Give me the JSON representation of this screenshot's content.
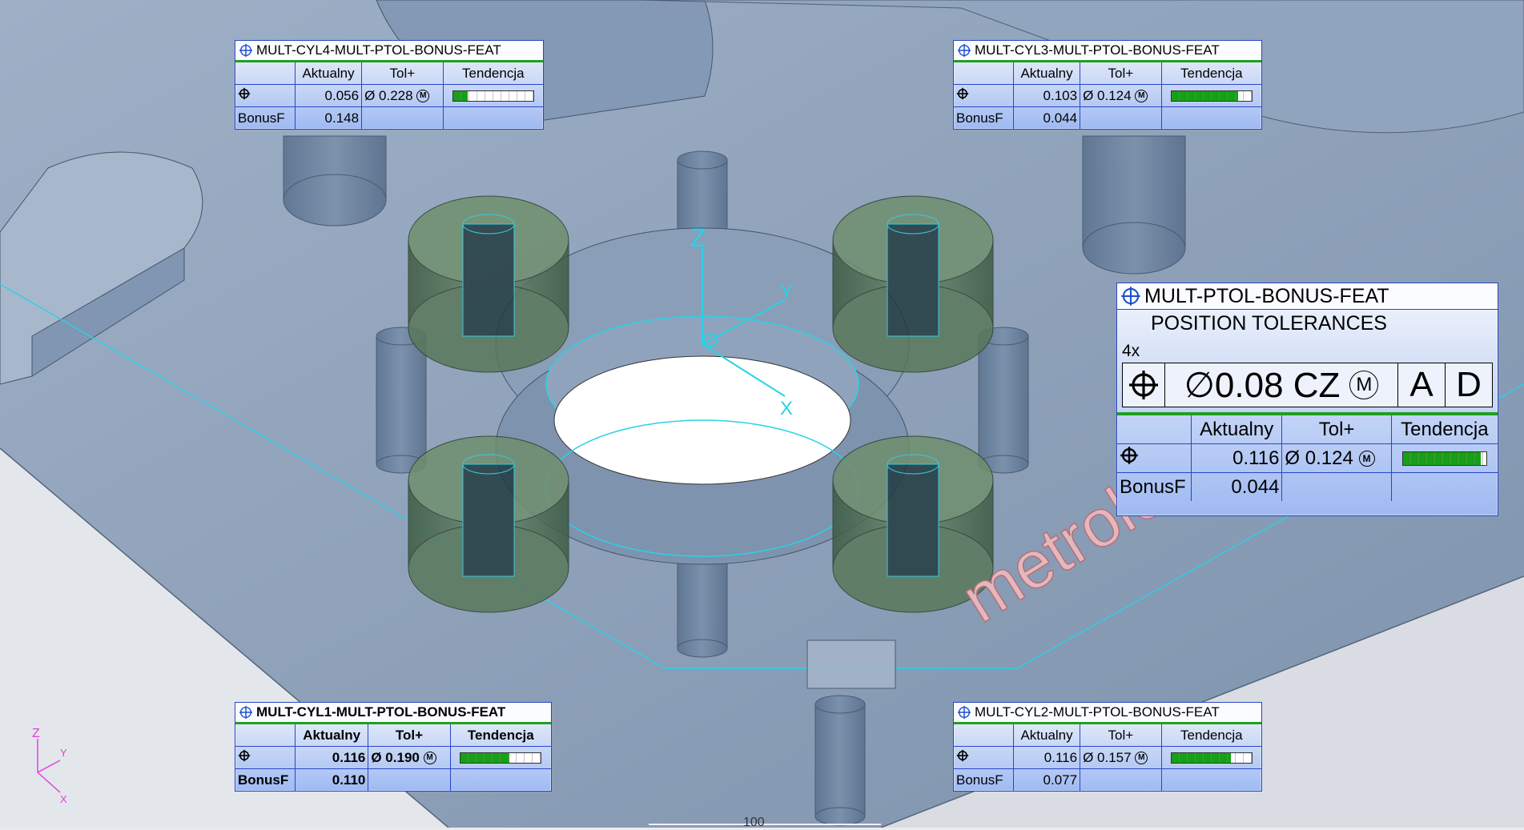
{
  "labels": [
    {
      "id": "cyl4",
      "title": "MULT-CYL4-MULT-PTOL-BONUS-FEAT",
      "headers": [
        "",
        "Aktualny",
        "Tol+",
        "Tendencja"
      ],
      "row1": {
        "actual": "0.056",
        "tol": "Ø 0.228",
        "modifier": "M",
        "trend": 0.18
      },
      "row2": {
        "label": "BonusF",
        "value": "0.148"
      }
    },
    {
      "id": "cyl3",
      "title": "MULT-CYL3-MULT-PTOL-BONUS-FEAT",
      "headers": [
        "",
        "Aktualny",
        "Tol+",
        "Tendencja"
      ],
      "row1": {
        "actual": "0.103",
        "tol": "Ø 0.124",
        "modifier": "M",
        "trend": 0.83
      },
      "row2": {
        "label": "BonusF",
        "value": "0.044"
      }
    },
    {
      "id": "cyl1",
      "title": "MULT-CYL1-MULT-PTOL-BONUS-FEAT",
      "headers": [
        "",
        "Aktualny",
        "Tol+",
        "Tendencja"
      ],
      "row1": {
        "actual": "0.116",
        "tol": "Ø 0.190",
        "modifier": "M",
        "trend": 0.61
      },
      "row2": {
        "label": "BonusF",
        "value": "0.110"
      }
    },
    {
      "id": "cyl2",
      "title": "MULT-CYL2-MULT-PTOL-BONUS-FEAT",
      "headers": [
        "",
        "Aktualny",
        "Tol+",
        "Tendencja"
      ],
      "row1": {
        "actual": "0.116",
        "tol": "Ø 0.157",
        "modifier": "M",
        "trend": 0.74
      },
      "row2": {
        "label": "BonusF",
        "value": "0.077"
      }
    }
  ],
  "main": {
    "title": "MULT-PTOL-BONUS-FEAT",
    "subtitle": "POSITION TOLERANCES",
    "count": "4x",
    "fcf": {
      "tolerance": "∅0.08 CZ",
      "modifier": "M",
      "datum1": "A",
      "datum2": "D"
    },
    "headers": [
      "",
      "Aktualny",
      "Tol+",
      "Tendencja"
    ],
    "row1": {
      "actual": "0.116",
      "tol": "Ø 0.124",
      "modifier": "M",
      "trend": 0.93
    },
    "row2": {
      "label": "BonusF",
      "value": "0.044"
    }
  },
  "axes": {
    "z": "Z",
    "y": "Y",
    "x": "X"
  },
  "mini_axes": {
    "z": "Z",
    "y": "Y",
    "x": "X"
  },
  "scale": "100",
  "watermark": "metrology"
}
